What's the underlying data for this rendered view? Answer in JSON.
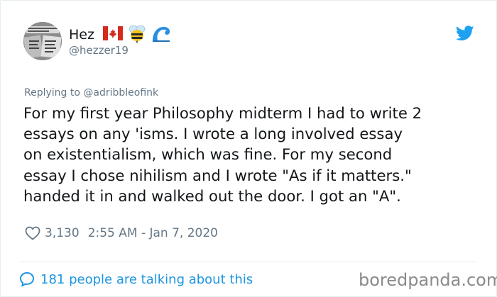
{
  "author": {
    "name": "Hez",
    "handle": "@hezzer19"
  },
  "icons": {
    "flag": "canada-flag-icon",
    "bee": "bee-icon",
    "wave": "wave-icon",
    "brand": "twitter-bird-icon",
    "heart": "heart-icon",
    "comment": "speech-bubble-icon"
  },
  "colors": {
    "brand": "#1da1f2",
    "link": "#1b95e0",
    "muted": "#657786",
    "text": "#14171a"
  },
  "reply": {
    "prefix": "Replying to ",
    "mention": "@adribbleofink"
  },
  "tweet_text": "For my first year Philosophy midterm I had to write 2\nessays on any 'isms. I wrote a long involved essay\non existentialism, which was fine. For my second\nessay I chose nihilism and I wrote \"As if it matters.\"\nhanded it in and walked out the door. I got an \"A\".",
  "meta": {
    "likes": "3,130",
    "timestamp": "2:55 AM - Jan 7, 2020"
  },
  "footer": {
    "talking": "181 people are talking about this"
  },
  "watermark": "boredpanda.com"
}
